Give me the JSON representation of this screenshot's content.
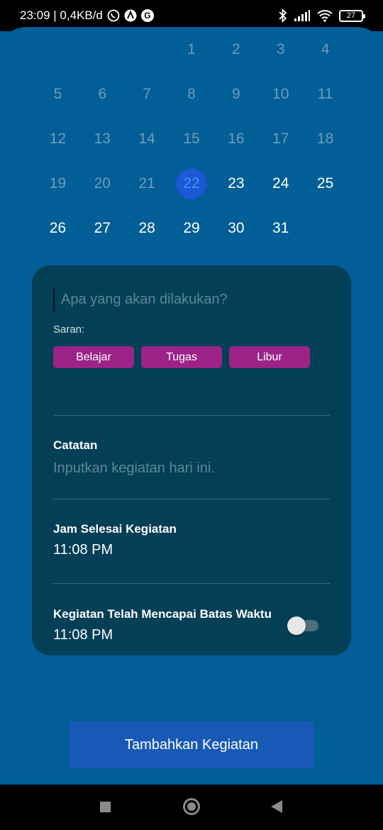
{
  "status_bar": {
    "time_speed": "23:09 | 0,4KB/d",
    "g_letter": "G",
    "battery": "27"
  },
  "calendar": {
    "selected_day": "22",
    "weeks": [
      [
        "",
        "",
        "",
        "1",
        "2",
        "3",
        "4"
      ],
      [
        "5",
        "6",
        "7",
        "8",
        "9",
        "10",
        "11"
      ],
      [
        "12",
        "13",
        "14",
        "15",
        "16",
        "17",
        "18"
      ],
      [
        "19",
        "20",
        "21",
        "22",
        "23",
        "24",
        "25"
      ],
      [
        "26",
        "27",
        "28",
        "29",
        "30",
        "31",
        ""
      ]
    ]
  },
  "form": {
    "activity_placeholder": "Apa yang akan dilakukan?",
    "suggestion_label": "Saran:",
    "suggestions": [
      "Belajar",
      "Tugas",
      "Libur"
    ],
    "notes_label": "Catatan",
    "notes_placeholder": "Inputkan kegiatan hari ini.",
    "end_time_label": "Jam Selesai Kegiatan",
    "end_time_value": "11:08 PM",
    "deadline_label": "Kegiatan Telah Mencapai Batas Waktu",
    "deadline_value": "11:08 PM",
    "deadline_toggle_on": false
  },
  "add_button_label": "Tambahkan Kegiatan",
  "colors": {
    "background": "#015e96",
    "card": "#033f56",
    "chip": "#9b2387",
    "primary_button": "#1859b5",
    "selected_day": "#1a58d4"
  }
}
